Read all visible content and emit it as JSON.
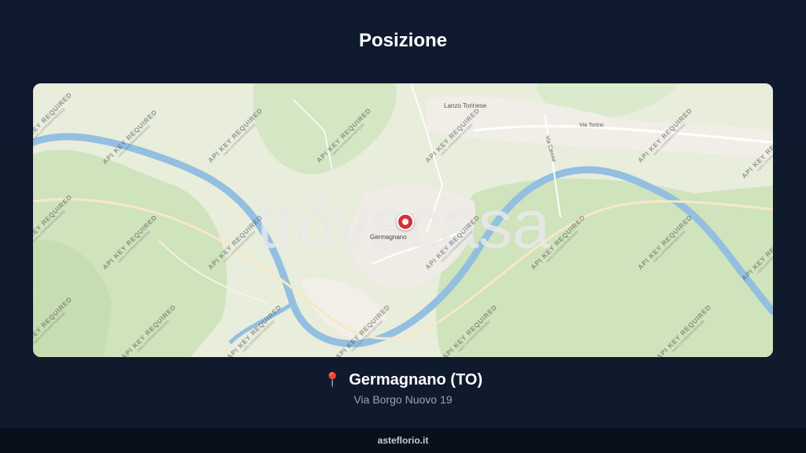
{
  "header": {
    "title": "Posizione"
  },
  "map": {
    "watermark": "trôvacasa",
    "marker_label": "Germagnano",
    "place_labels": [
      "Lanzo Torinese",
      "Via Torino",
      "Via Cavour"
    ],
    "api_notice": "API KEY REQUIRED",
    "api_notice_sub": "carto.com/basemaps/pay",
    "colors": {
      "river": "#93bfe0",
      "green": "#cfe3bd",
      "marker": "#d6303c"
    }
  },
  "location": {
    "pin_icon": "round-pushpin-icon",
    "name": "Germagnano (TO)",
    "address": "Via Borgo Nuovo 19"
  },
  "footer": {
    "site": "asteflorio.it"
  }
}
